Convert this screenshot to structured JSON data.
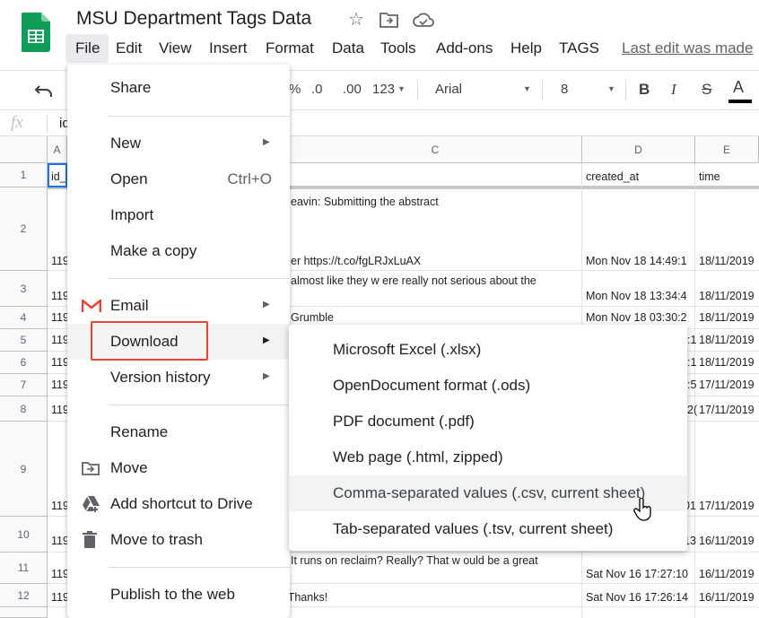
{
  "app": {
    "doc_title": "MSU Department Tags Data",
    "last_edit": "Last edit was made",
    "menus": [
      "File",
      "Edit",
      "View",
      "Insert",
      "Format",
      "Data",
      "Tools",
      "Add-ons",
      "Help",
      "TAGS"
    ]
  },
  "toolbar": {
    "percent": "%",
    "dec_decrease": ".0",
    "dec_increase": ".00",
    "format_more": "123",
    "font": "Arial",
    "font_size": "8",
    "bold": "B",
    "italic": "I",
    "strike": "S",
    "text_color": "A"
  },
  "formula_bar": {
    "fx": "fx",
    "value": "id"
  },
  "grid": {
    "columns": [
      "A",
      "C",
      "D",
      "E"
    ],
    "rows": [
      "1",
      "2",
      "3",
      "4",
      "5",
      "6",
      "7",
      "8",
      "9",
      "10",
      "11",
      "12"
    ],
    "header_row": {
      "a": "id_",
      "d": "created_at",
      "e": "time"
    },
    "r2": {
      "a": "119",
      "c1": "eavin: Submitting the abstract",
      "c2": "er https://t.co/fgLRJxLuAX",
      "d": "Mon Nov 18 14:49:1",
      "e": "18/11/2019"
    },
    "r3": {
      "a": "119",
      "c": "almost like they w ere really not serious about the",
      "d": "Mon Nov 18 13:34:4",
      "e": "18/11/2019"
    },
    "r4": {
      "a": "119",
      "c": "Grumble",
      "d": "Mon Nov 18 03:30:2",
      "e": "18/11/2019"
    },
    "r5": {
      "a": "119",
      "d": ":1",
      "e": "18/11/2019"
    },
    "r6": {
      "a": "119",
      "d": ":1",
      "e": "18/11/2019"
    },
    "r7": {
      "a": "119",
      "d": ":5",
      "e": "17/11/2019"
    },
    "r8": {
      "a": "119",
      "d": "2(",
      "e": "17/11/2019"
    },
    "r9": {
      "a": "119",
      "d": "01",
      "e": "17/11/2019"
    },
    "r10": {
      "a": "119",
      "d": "13",
      "e": "16/11/2019"
    },
    "r11": {
      "a": "119",
      "c": "It runs on reclaim? Really? That w ould be a great",
      "d": "Sat Nov 16 17:27:10",
      "e": "16/11/2019"
    },
    "r12": {
      "a": "119",
      "c": "/ Thanks!",
      "d": "Sat Nov 16 17:26:14",
      "e": "16/11/2019"
    }
  },
  "file_menu": {
    "share": "Share",
    "new": "New",
    "open": "Open",
    "open_kb": "Ctrl+O",
    "import": "Import",
    "make_copy": "Make a copy",
    "email": "Email",
    "download": "Download",
    "version_history": "Version history",
    "rename": "Rename",
    "move": "Move",
    "add_shortcut": "Add shortcut to Drive",
    "move_trash": "Move to trash",
    "publish": "Publish to the web"
  },
  "download_menu": {
    "xlsx": "Microsoft Excel (.xlsx)",
    "ods": "OpenDocument format (.ods)",
    "pdf": "PDF document (.pdf)",
    "html": "Web page (.html, zipped)",
    "csv": "Comma-separated values (.csv, current sheet)",
    "tsv": "Tab-separated values (.tsv, current sheet)"
  },
  "colors": {
    "sheets_green": "#0f9d58",
    "highlight_red": "#ea4335",
    "gmail_red": "#ea4335"
  }
}
